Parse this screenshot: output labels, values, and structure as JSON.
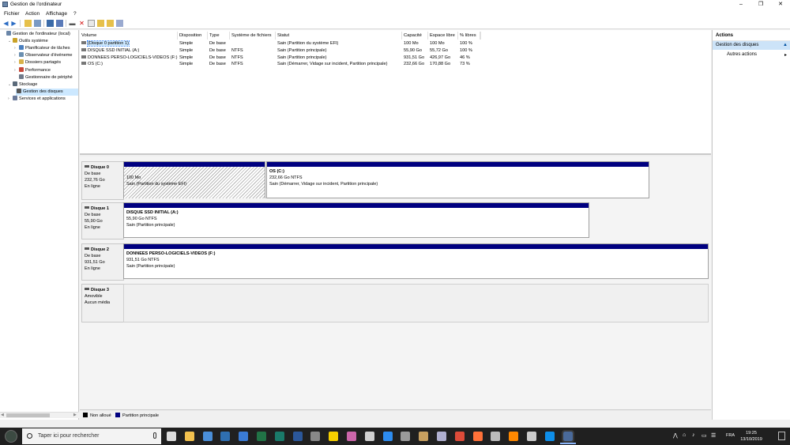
{
  "window": {
    "title": "Gestion de l'ordinateur",
    "minimize": "–",
    "maximize": "❐",
    "close": "✕"
  },
  "menu": [
    "Fichier",
    "Action",
    "Affichage",
    "?"
  ],
  "toolbar": {
    "icons": [
      "back-icon",
      "forward-icon",
      "up-folder-icon",
      "show-hide-tree-icon",
      "properties-icon",
      "help-icon",
      "connect-drive-icon",
      "delete-icon",
      "format-icon",
      "open-icon",
      "explore-icon",
      "refresh-icon"
    ]
  },
  "tree": {
    "items": [
      {
        "label": "Gestion de l'ordinateur (local)",
        "level": 0,
        "arrow": "",
        "color": "#6a86a8"
      },
      {
        "label": "Outils système",
        "level": 1,
        "arrow": "⌄",
        "color": "#c9a227"
      },
      {
        "label": "Planificateur de tâches",
        "level": 2,
        "arrow": "›",
        "color": "#4a7fbf"
      },
      {
        "label": "Observateur d'événeme",
        "level": 2,
        "arrow": "›",
        "color": "#6b8fb0"
      },
      {
        "label": "Dossiers partagés",
        "level": 2,
        "arrow": "›",
        "color": "#d8b24a"
      },
      {
        "label": "Performance",
        "level": 2,
        "arrow": "›",
        "color": "#c8493a"
      },
      {
        "label": "Gestionnaire de périphé",
        "level": 2,
        "arrow": "",
        "color": "#707a8a"
      },
      {
        "label": "Stockage",
        "level": 1,
        "arrow": "⌄",
        "color": "#5a6a7a"
      },
      {
        "label": "Gestion des disques",
        "level": 2,
        "arrow": "",
        "color": "#555555",
        "selected": true
      },
      {
        "label": "Services et applications",
        "level": 1,
        "arrow": "›",
        "color": "#6a7a9a"
      }
    ]
  },
  "volumes": {
    "headers": [
      "Volume",
      "Disposition",
      "Type",
      "Système de fichiers",
      "Statut",
      "Capacité",
      "Espace libre",
      "% libres"
    ],
    "rows": [
      [
        "(Disque 0 partition 1)",
        "Simple",
        "De base",
        "",
        "Sain (Partition du système EFI)",
        "100 Mo",
        "100 Mo",
        "100 %"
      ],
      [
        "DISQUE SSD INITIAL (A:)",
        "Simple",
        "De base",
        "NTFS",
        "Sain (Partition principale)",
        "55,90 Go",
        "55,72 Go",
        "100 %"
      ],
      [
        "DONNEES PERSO-LOGICIELS-VIDEOS (F:)",
        "Simple",
        "De base",
        "NTFS",
        "Sain (Partition principale)",
        "931,51 Go",
        "426,97 Go",
        "46 %"
      ],
      [
        "OS (C:)",
        "Simple",
        "De base",
        "NTFS",
        "Sain (Démarrer, Vidage sur incident, Partition principale)",
        "232,66 Go",
        "170,88 Go",
        "73 %"
      ]
    ]
  },
  "disks": [
    {
      "name": "Disque 0",
      "type": "De base",
      "size": "232,76 Go",
      "state": "En ligne",
      "partitions": [
        {
          "title": "",
          "line1": "100 Mo",
          "line2": "Sain (Partition du système EFI)",
          "hatched": true
        },
        {
          "title": "OS  (C:)",
          "line1": "232,66 Go NTFS",
          "line2": "Sain (Démarrer, Vidage sur incident, Partition principale)",
          "hatched": false
        }
      ]
    },
    {
      "name": "Disque 1",
      "type": "De base",
      "size": "55,90 Go",
      "state": "En ligne",
      "partitions": [
        {
          "title": "DISQUE SSD INITIAL  (A:)",
          "line1": "55,90 Go NTFS",
          "line2": "Sain (Partition principale)",
          "hatched": false
        }
      ]
    },
    {
      "name": "Disque 2",
      "type": "De base",
      "size": "931,51 Go",
      "state": "En ligne",
      "partitions": [
        {
          "title": "DONNEES PERSO-LOGICIELS-VIDEOS  (F:)",
          "line1": "931,51 Go NTFS",
          "line2": "Sain (Partition principale)",
          "hatched": false
        }
      ]
    },
    {
      "name": "Disque 3",
      "type": "Amovible",
      "size": "",
      "state": "Aucun média",
      "partitions": []
    }
  ],
  "legend": [
    {
      "label": "Non alloué",
      "color": "#000000"
    },
    {
      "label": "Partition principale",
      "color": "#000080"
    }
  ],
  "actions": {
    "header": "Actions",
    "section": "Gestion des disques",
    "section_arrow": "▲",
    "item": "Autres actions",
    "item_arrow": "▸"
  },
  "taskbar": {
    "search_placeholder": "Taper ici pour rechercher",
    "apps": [
      {
        "name": "task-view-icon",
        "color": "#dddddd"
      },
      {
        "name": "file-explorer-icon",
        "color": "#f2c14e"
      },
      {
        "name": "mail-icon",
        "color": "#4a8fd9"
      },
      {
        "name": "m-app-icon",
        "color": "#2f6fb0"
      },
      {
        "name": "photos-icon",
        "color": "#3a7bd5"
      },
      {
        "name": "excel-icon",
        "color": "#217346"
      },
      {
        "name": "publisher-icon",
        "color": "#1a7a6a"
      },
      {
        "name": "word-icon",
        "color": "#2b579a"
      },
      {
        "name": "media-icon",
        "color": "#888888"
      },
      {
        "name": "sticky-notes-icon",
        "color": "#f7d000"
      },
      {
        "name": "picasa-icon",
        "color": "#cc66aa"
      },
      {
        "name": "paint-icon",
        "color": "#d0d0d0"
      },
      {
        "name": "store-icon",
        "color": "#2d8cf0"
      },
      {
        "name": "media-player-icon",
        "color": "#9a9a9a"
      },
      {
        "name": "tools-icon",
        "color": "#c8a060"
      },
      {
        "name": "itunes-icon",
        "color": "#b0b0d0"
      },
      {
        "name": "chrome-icon",
        "color": "#dd4b39"
      },
      {
        "name": "firefox-icon",
        "color": "#ff7139"
      },
      {
        "name": "monitor-icon",
        "color": "#bbbbbb"
      },
      {
        "name": "vlc-icon",
        "color": "#ff8800"
      },
      {
        "name": "spreadsheet-icon",
        "color": "#cccccc"
      },
      {
        "name": "teamviewer-icon",
        "color": "#0e8ee9"
      },
      {
        "name": "computer-management-icon",
        "color": "#4a6a9a"
      }
    ],
    "tray": [
      "⋀",
      "⌂",
      "♪",
      "▭",
      "☰"
    ],
    "lang": "FRA",
    "time": "19:25",
    "date": "13/10/2019"
  }
}
